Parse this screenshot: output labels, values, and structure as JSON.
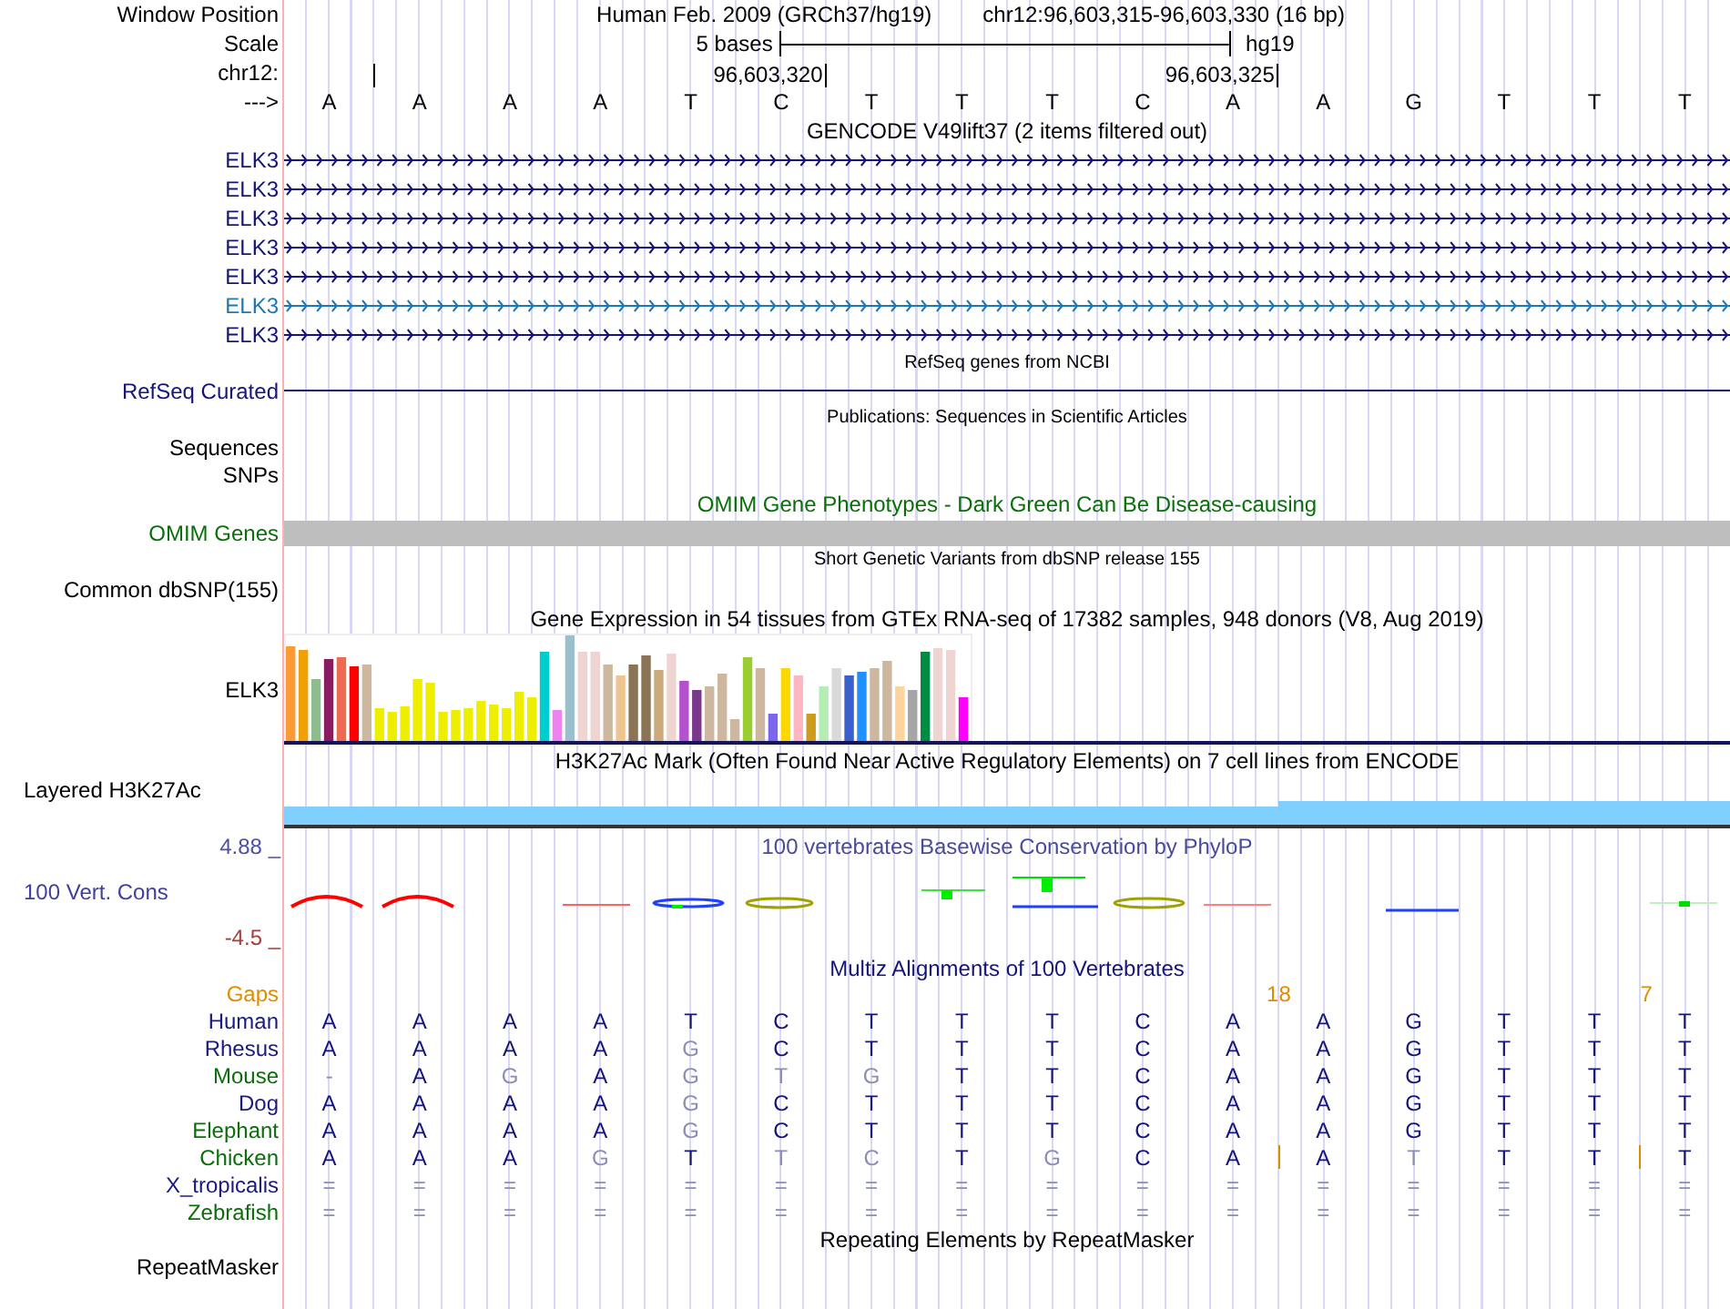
{
  "ruler": {
    "labels": [
      "Window Position",
      "Scale",
      "chr12:",
      "--->"
    ],
    "assembly": "Human Feb. 2009 (GRCh37/hg19)",
    "position": "chr12:96,603,315-96,603,330 (16 bp)",
    "scale_text": "5 bases",
    "scale_db": "hg19",
    "coord_1": "96,603,320",
    "coord_2": "96,603,325",
    "bases": [
      "A",
      "A",
      "A",
      "A",
      "T",
      "C",
      "T",
      "T",
      "T",
      "C",
      "A",
      "A",
      "G",
      "T",
      "T",
      "T"
    ]
  },
  "gencode": {
    "title": "GENCODE V49lift37 (2 items filtered out)",
    "items": [
      {
        "label": "ELK3",
        "selected": false
      },
      {
        "label": "ELK3",
        "selected": false
      },
      {
        "label": "ELK3",
        "selected": false
      },
      {
        "label": "ELK3",
        "selected": false
      },
      {
        "label": "ELK3",
        "selected": false
      },
      {
        "label": "ELK3",
        "selected": true
      },
      {
        "label": "ELK3",
        "selected": false
      }
    ]
  },
  "refseq": {
    "title": "RefSeq genes from NCBI",
    "label": "RefSeq Curated"
  },
  "publications": {
    "title": "Publications: Sequences in Scientific Articles",
    "labels": [
      "Sequences",
      "SNPs"
    ]
  },
  "omim": {
    "title": "OMIM Gene Phenotypes - Dark Green Can Be Disease-causing",
    "label": "OMIM Genes"
  },
  "dbsnp": {
    "title": "Short Genetic Variants from dbSNP release 155",
    "label": "Common dbSNP(155)"
  },
  "gtex": {
    "title": "Gene Expression in 54 tissues from GTEx RNA-seq of 17382 samples, 948 donors (V8, Aug 2019)",
    "label": "ELK3"
  },
  "h3k27ac": {
    "title": "H3K27Ac Mark (Often Found Near Active Regulatory Elements) on 7 cell lines from ENCODE",
    "label": "Layered H3K27Ac"
  },
  "phylop": {
    "title": "100 vertebrates Basewise Conservation by PhyloP",
    "label": "100 Vert. Cons",
    "max": "4.88 _",
    "min": "-4.5 _"
  },
  "multiz": {
    "title": "Multiz Alignments of 100 Vertebrates",
    "gaps_label": "Gaps",
    "gap_counts": [
      "18",
      "7"
    ],
    "species": [
      {
        "name": "Human",
        "color": "#1a1a80",
        "bases": [
          {
            "b": "A",
            "match": true
          },
          {
            "b": "A",
            "match": true
          },
          {
            "b": "A",
            "match": true
          },
          {
            "b": "A",
            "match": true
          },
          {
            "b": "T",
            "match": true
          },
          {
            "b": "C",
            "match": true
          },
          {
            "b": "T",
            "match": true
          },
          {
            "b": "T",
            "match": true
          },
          {
            "b": "T",
            "match": true
          },
          {
            "b": "C",
            "match": true
          },
          {
            "b": "A",
            "match": true
          },
          {
            "b": "A",
            "match": true
          },
          {
            "b": "G",
            "match": true
          },
          {
            "b": "T",
            "match": true
          },
          {
            "b": "T",
            "match": true
          },
          {
            "b": "T",
            "match": true
          }
        ]
      },
      {
        "name": "Rhesus",
        "color": "#1a1a80",
        "bases": [
          {
            "b": "A",
            "match": true
          },
          {
            "b": "A",
            "match": true
          },
          {
            "b": "A",
            "match": true
          },
          {
            "b": "A",
            "match": true
          },
          {
            "b": "G",
            "match": false
          },
          {
            "b": "C",
            "match": true
          },
          {
            "b": "T",
            "match": true
          },
          {
            "b": "T",
            "match": true
          },
          {
            "b": "T",
            "match": true
          },
          {
            "b": "C",
            "match": true
          },
          {
            "b": "A",
            "match": true
          },
          {
            "b": "A",
            "match": true
          },
          {
            "b": "G",
            "match": true
          },
          {
            "b": "T",
            "match": true
          },
          {
            "b": "T",
            "match": true
          },
          {
            "b": "T",
            "match": true
          }
        ]
      },
      {
        "name": "Mouse",
        "color": "#0a6e0a",
        "bases": [
          {
            "b": "-",
            "match": false
          },
          {
            "b": "A",
            "match": true
          },
          {
            "b": "G",
            "match": false
          },
          {
            "b": "A",
            "match": true
          },
          {
            "b": "G",
            "match": false
          },
          {
            "b": "T",
            "match": false
          },
          {
            "b": "G",
            "match": false
          },
          {
            "b": "T",
            "match": true
          },
          {
            "b": "T",
            "match": true
          },
          {
            "b": "C",
            "match": true
          },
          {
            "b": "A",
            "match": true
          },
          {
            "b": "A",
            "match": true
          },
          {
            "b": "G",
            "match": true
          },
          {
            "b": "T",
            "match": true
          },
          {
            "b": "T",
            "match": true
          },
          {
            "b": "T",
            "match": true
          }
        ]
      },
      {
        "name": "Dog",
        "color": "#1a1a80",
        "bases": [
          {
            "b": "A",
            "match": true
          },
          {
            "b": "A",
            "match": true
          },
          {
            "b": "A",
            "match": true
          },
          {
            "b": "A",
            "match": true
          },
          {
            "b": "G",
            "match": false
          },
          {
            "b": "C",
            "match": true
          },
          {
            "b": "T",
            "match": true
          },
          {
            "b": "T",
            "match": true
          },
          {
            "b": "T",
            "match": true
          },
          {
            "b": "C",
            "match": true
          },
          {
            "b": "A",
            "match": true
          },
          {
            "b": "A",
            "match": true
          },
          {
            "b": "G",
            "match": true
          },
          {
            "b": "T",
            "match": true
          },
          {
            "b": "T",
            "match": true
          },
          {
            "b": "T",
            "match": true
          }
        ]
      },
      {
        "name": "Elephant",
        "color": "#0a6e0a",
        "bases": [
          {
            "b": "A",
            "match": true
          },
          {
            "b": "A",
            "match": true
          },
          {
            "b": "A",
            "match": true
          },
          {
            "b": "A",
            "match": true
          },
          {
            "b": "G",
            "match": false
          },
          {
            "b": "C",
            "match": true
          },
          {
            "b": "T",
            "match": true
          },
          {
            "b": "T",
            "match": true
          },
          {
            "b": "T",
            "match": true
          },
          {
            "b": "C",
            "match": true
          },
          {
            "b": "A",
            "match": true
          },
          {
            "b": "A",
            "match": true
          },
          {
            "b": "G",
            "match": true
          },
          {
            "b": "T",
            "match": true
          },
          {
            "b": "T",
            "match": true
          },
          {
            "b": "T",
            "match": true
          }
        ]
      },
      {
        "name": "Chicken",
        "color": "#0a6e0a",
        "bases": [
          {
            "b": "A",
            "match": true,
            "insert": false
          },
          {
            "b": "A",
            "match": true,
            "insert": false
          },
          {
            "b": "A",
            "match": true,
            "insert": false
          },
          {
            "b": "G",
            "match": false,
            "insert": false
          },
          {
            "b": "T",
            "match": true,
            "insert": false
          },
          {
            "b": "T",
            "match": false,
            "insert": false
          },
          {
            "b": "C",
            "match": false,
            "insert": false
          },
          {
            "b": "T",
            "match": true,
            "insert": false
          },
          {
            "b": "G",
            "match": false,
            "insert": false
          },
          {
            "b": "C",
            "match": true,
            "insert": false
          },
          {
            "b": "A",
            "match": true,
            "insert": true
          },
          {
            "b": "A",
            "match": true,
            "insert": false
          },
          {
            "b": "T",
            "match": false,
            "insert": false
          },
          {
            "b": "T",
            "match": true,
            "insert": false
          },
          {
            "b": "T",
            "match": true,
            "insert": true
          },
          {
            "b": "T",
            "match": true,
            "insert": false
          }
        ]
      },
      {
        "name": "X_tropicalis",
        "color": "#1a1a80",
        "bases": [
          {
            "b": "=",
            "match": false
          },
          {
            "b": "=",
            "match": false
          },
          {
            "b": "=",
            "match": false
          },
          {
            "b": "=",
            "match": false
          },
          {
            "b": "=",
            "match": false
          },
          {
            "b": "=",
            "match": false
          },
          {
            "b": "=",
            "match": false
          },
          {
            "b": "=",
            "match": false
          },
          {
            "b": "=",
            "match": false
          },
          {
            "b": "=",
            "match": false
          },
          {
            "b": "=",
            "match": false
          },
          {
            "b": "=",
            "match": false
          },
          {
            "b": "=",
            "match": false
          },
          {
            "b": "=",
            "match": false
          },
          {
            "b": "=",
            "match": false
          },
          {
            "b": "=",
            "match": false
          }
        ]
      },
      {
        "name": "Zebrafish",
        "color": "#0a6e0a",
        "bases": [
          {
            "b": "=",
            "match": false
          },
          {
            "b": "=",
            "match": false
          },
          {
            "b": "=",
            "match": false
          },
          {
            "b": "=",
            "match": false
          },
          {
            "b": "=",
            "match": false
          },
          {
            "b": "=",
            "match": false
          },
          {
            "b": "=",
            "match": false
          },
          {
            "b": "=",
            "match": false
          },
          {
            "b": "=",
            "match": false
          },
          {
            "b": "=",
            "match": false
          },
          {
            "b": "=",
            "match": false
          },
          {
            "b": "=",
            "match": false
          },
          {
            "b": "=",
            "match": false
          },
          {
            "b": "=",
            "match": false
          },
          {
            "b": "=",
            "match": false
          },
          {
            "b": "=",
            "match": false
          }
        ]
      }
    ]
  },
  "repeatmasker": {
    "title": "Repeating Elements by RepeatMasker",
    "label": "RepeatMasker"
  }
}
